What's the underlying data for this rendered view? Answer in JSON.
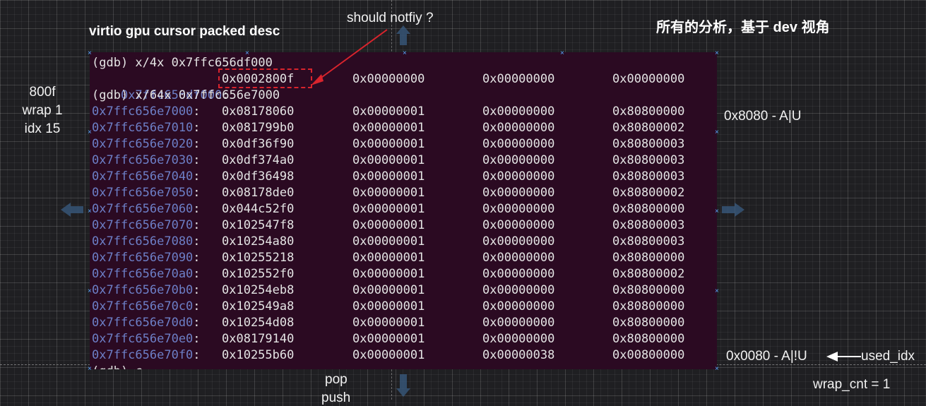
{
  "title": "virtio gpu cursor packed desc",
  "cn_note": "所有的分析，基于 dev 视角",
  "notify_label": "should notfiy ?",
  "left_notes": {
    "line1": "800f",
    "line2": "wrap 1",
    "line3": "idx 15"
  },
  "right_notes": {
    "flags_top": "0x8080 - A|U",
    "flags_bottom": "0x0080 - A|!U",
    "used_idx": "used_idx",
    "wrap_cnt": "wrap_cnt = 1"
  },
  "bottom_notes": {
    "pop": "pop",
    "push": "push"
  },
  "terminal": {
    "cmd1": "(gdb) x/4x 0x7ffc656df000",
    "row0": {
      "addr": "0x7ffc656df000",
      "v": [
        "0x0002800f",
        "0x00000000",
        "0x00000000",
        "0x00000000"
      ]
    },
    "cmd2": "(gdb) x/64x 0x7ffc656e7000",
    "rows": [
      {
        "addr": "0x7ffc656e7000",
        "v": [
          "0x08178060",
          "0x00000001",
          "0x00000000",
          "0x80800000"
        ]
      },
      {
        "addr": "0x7ffc656e7010",
        "v": [
          "0x081799b0",
          "0x00000001",
          "0x00000000",
          "0x80800002"
        ]
      },
      {
        "addr": "0x7ffc656e7020",
        "v": [
          "0x0df36f90",
          "0x00000001",
          "0x00000000",
          "0x80800003"
        ]
      },
      {
        "addr": "0x7ffc656e7030",
        "v": [
          "0x0df374a0",
          "0x00000001",
          "0x00000000",
          "0x80800003"
        ]
      },
      {
        "addr": "0x7ffc656e7040",
        "v": [
          "0x0df36498",
          "0x00000001",
          "0x00000000",
          "0x80800003"
        ]
      },
      {
        "addr": "0x7ffc656e7050",
        "v": [
          "0x08178de0",
          "0x00000001",
          "0x00000000",
          "0x80800002"
        ]
      },
      {
        "addr": "0x7ffc656e7060",
        "v": [
          "0x044c52f0",
          "0x00000001",
          "0x00000000",
          "0x80800000"
        ]
      },
      {
        "addr": "0x7ffc656e7070",
        "v": [
          "0x102547f8",
          "0x00000001",
          "0x00000000",
          "0x80800003"
        ]
      },
      {
        "addr": "0x7ffc656e7080",
        "v": [
          "0x10254a80",
          "0x00000001",
          "0x00000000",
          "0x80800003"
        ]
      },
      {
        "addr": "0x7ffc656e7090",
        "v": [
          "0x10255218",
          "0x00000001",
          "0x00000000",
          "0x80800000"
        ]
      },
      {
        "addr": "0x7ffc656e70a0",
        "v": [
          "0x102552f0",
          "0x00000001",
          "0x00000000",
          "0x80800002"
        ]
      },
      {
        "addr": "0x7ffc656e70b0",
        "v": [
          "0x10254eb8",
          "0x00000001",
          "0x00000000",
          "0x80800000"
        ]
      },
      {
        "addr": "0x7ffc656e70c0",
        "v": [
          "0x102549a8",
          "0x00000001",
          "0x00000000",
          "0x80800000"
        ]
      },
      {
        "addr": "0x7ffc656e70d0",
        "v": [
          "0x10254d08",
          "0x00000001",
          "0x00000000",
          "0x80800000"
        ]
      },
      {
        "addr": "0x7ffc656e70e0",
        "v": [
          "0x08179140",
          "0x00000001",
          "0x00000000",
          "0x80800000"
        ]
      },
      {
        "addr": "0x7ffc656e70f0",
        "v": [
          "0x10255b60",
          "0x00000001",
          "0x00000038",
          "0x00800000"
        ]
      }
    ],
    "cmd3": "(gdb) c"
  },
  "colors": {
    "terminal_bg": "#2b0a22",
    "address": "#6d7fc7",
    "annotation_red": "#d9242d",
    "grid_bg": "#1f1f22"
  }
}
